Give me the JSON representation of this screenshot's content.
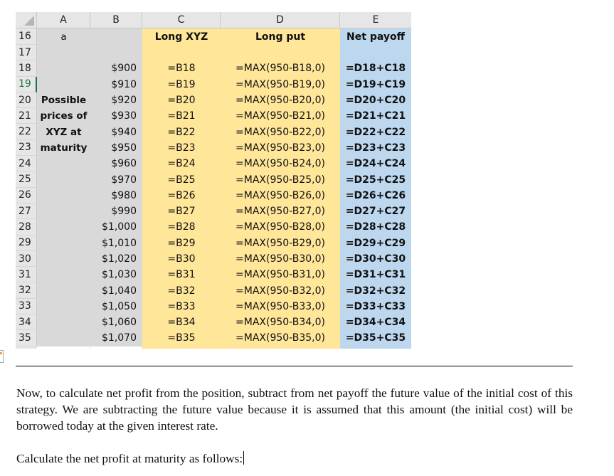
{
  "spreadsheet": {
    "column_headers": [
      "A",
      "B",
      "C",
      "D",
      "E"
    ],
    "header_row": {
      "row_number": "16",
      "A": "a",
      "B": "",
      "C": "Long XYZ",
      "D": "Long put",
      "E": "Net payoff"
    },
    "blank_row_number": "17",
    "selected_row": "19",
    "row_label_lines": [
      "Possible",
      "prices of",
      "XYZ at",
      "maturity"
    ],
    "rows": [
      {
        "row": "18",
        "A": "",
        "B": "$900",
        "C": "=B18",
        "D": "=MAX(950-B18,0)",
        "E": "=D18+C18"
      },
      {
        "row": "19",
        "A": "",
        "B": "$910",
        "C": "=B19",
        "D": "=MAX(950-B19,0)",
        "E": "=D19+C19"
      },
      {
        "row": "20",
        "A": "Possible",
        "B": "$920",
        "C": "=B20",
        "D": "=MAX(950-B20,0)",
        "E": "=D20+C20"
      },
      {
        "row": "21",
        "A": "prices of",
        "B": "$930",
        "C": "=B21",
        "D": "=MAX(950-B21,0)",
        "E": "=D21+C21"
      },
      {
        "row": "22",
        "A": "XYZ at",
        "B": "$940",
        "C": "=B22",
        "D": "=MAX(950-B22,0)",
        "E": "=D22+C22"
      },
      {
        "row": "23",
        "A": "maturity",
        "B": "$950",
        "C": "=B23",
        "D": "=MAX(950-B23,0)",
        "E": "=D23+C23"
      },
      {
        "row": "24",
        "A": "",
        "B": "$960",
        "C": "=B24",
        "D": "=MAX(950-B24,0)",
        "E": "=D24+C24"
      },
      {
        "row": "25",
        "A": "",
        "B": "$970",
        "C": "=B25",
        "D": "=MAX(950-B25,0)",
        "E": "=D25+C25"
      },
      {
        "row": "26",
        "A": "",
        "B": "$980",
        "C": "=B26",
        "D": "=MAX(950-B26,0)",
        "E": "=D26+C26"
      },
      {
        "row": "27",
        "A": "",
        "B": "$990",
        "C": "=B27",
        "D": "=MAX(950-B27,0)",
        "E": "=D27+C27"
      },
      {
        "row": "28",
        "A": "",
        "B": "$1,000",
        "C": "=B28",
        "D": "=MAX(950-B28,0)",
        "E": "=D28+C28"
      },
      {
        "row": "29",
        "A": "",
        "B": "$1,010",
        "C": "=B29",
        "D": "=MAX(950-B29,0)",
        "E": "=D29+C29"
      },
      {
        "row": "30",
        "A": "",
        "B": "$1,020",
        "C": "=B30",
        "D": "=MAX(950-B30,0)",
        "E": "=D30+C30"
      },
      {
        "row": "31",
        "A": "",
        "B": "$1,030",
        "C": "=B31",
        "D": "=MAX(950-B31,0)",
        "E": "=D31+C31"
      },
      {
        "row": "32",
        "A": "",
        "B": "$1,040",
        "C": "=B32",
        "D": "=MAX(950-B32,0)",
        "E": "=D32+C32"
      },
      {
        "row": "33",
        "A": "",
        "B": "$1,050",
        "C": "=B33",
        "D": "=MAX(950-B33,0)",
        "E": "=D33+C33"
      },
      {
        "row": "34",
        "A": "",
        "B": "$1,060",
        "C": "=B34",
        "D": "=MAX(950-B34,0)",
        "E": "=D34+C34"
      },
      {
        "row": "35",
        "A": "",
        "B": "$1,070",
        "C": "=B35",
        "D": "=MAX(950-B35,0)",
        "E": "=D35+C35"
      }
    ],
    "colors": {
      "grey_fill": "#d9d9d9",
      "yellow_fill": "#ffe699",
      "blue_fill": "#bdd7ee",
      "header_fill": "#e6e6e6",
      "selection_green": "#217346"
    }
  },
  "document": {
    "paragraph_1": "Now, to calculate net profit from the position, subtract from net payoff the future value of the initial cost of this strategy. We are subtracting the future value because it is assumed that this amount (the initial cost) will be borrowed today at the given interest rate.",
    "paragraph_2": "Calculate the net profit at maturity as follows:"
  }
}
